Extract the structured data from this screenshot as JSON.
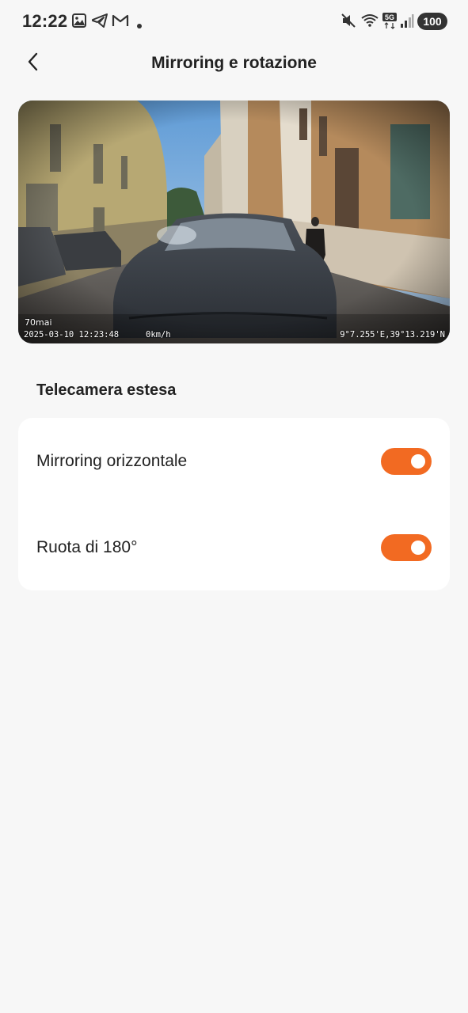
{
  "status_bar": {
    "time": "12:22",
    "network_label": "5G",
    "battery": "100",
    "left_icons": [
      "gallery-icon",
      "telegram-icon",
      "gmail-icon",
      "dot-icon"
    ],
    "right_icons": [
      "mute-icon",
      "wifi-icon",
      "5g-icon",
      "signal-icon",
      "battery-icon"
    ]
  },
  "header": {
    "title": "Mirroring e rotazione",
    "back_icon": "chevron-left-icon"
  },
  "preview": {
    "brand": "70mai",
    "datetime": "2025-03-10 12:23:48",
    "speed": "0km/h",
    "coords": "9°7.255'E,39°13.219'N"
  },
  "section": {
    "title": "Telecamera estesa"
  },
  "settings": [
    {
      "label": "Mirroring orizzontale",
      "enabled": true
    },
    {
      "label": "Ruota di 180°",
      "enabled": true
    }
  ],
  "colors": {
    "accent": "#f26a22",
    "background": "#f7f7f7",
    "card": "#ffffff"
  }
}
